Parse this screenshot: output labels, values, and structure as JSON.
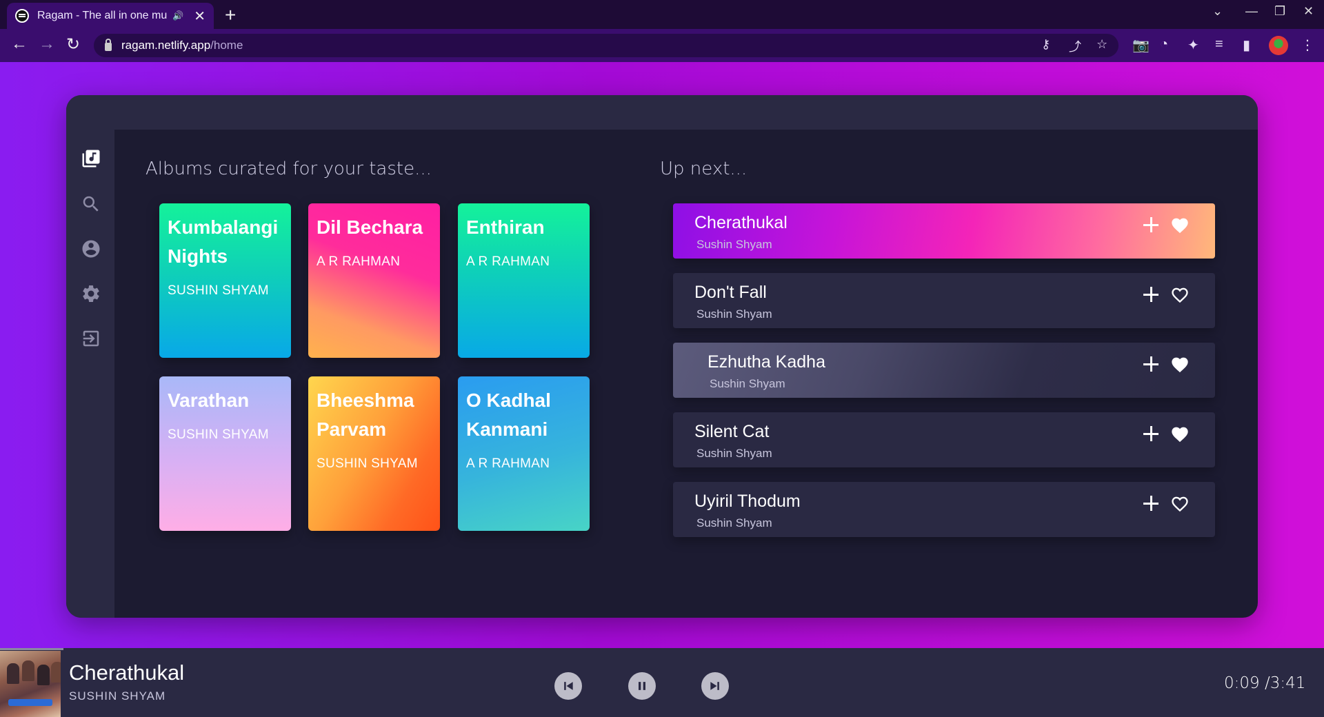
{
  "browser": {
    "tab_title": "Ragam - The all in one mu",
    "url_host": "ragam.netlify.app",
    "url_path": "/home"
  },
  "sidebar": {
    "items": [
      {
        "icon": "library-music-icon",
        "active": true
      },
      {
        "icon": "search-icon",
        "active": false
      },
      {
        "icon": "account-icon",
        "active": false
      },
      {
        "icon": "settings-icon",
        "active": false
      },
      {
        "icon": "logout-icon",
        "active": false
      }
    ]
  },
  "albums_section": {
    "title": "Albums curated for your taste...",
    "albums": [
      {
        "title": "Kumbalangi Nights",
        "artist": "SUSHIN SHYAM"
      },
      {
        "title": "Dil Bechara",
        "artist": "A R RAHMAN"
      },
      {
        "title": "Enthiran",
        "artist": "A R RAHMAN"
      },
      {
        "title": "Varathan",
        "artist": "SUSHIN SHYAM"
      },
      {
        "title": "Bheeshma Parvam",
        "artist": "SUSHIN SHYAM"
      },
      {
        "title": "O Kadhal Kanmani",
        "artist": "A R RAHMAN"
      }
    ]
  },
  "queue_section": {
    "title": "Up next...",
    "songs": [
      {
        "title": "Cherathukal",
        "artist": "Sushin Shyam",
        "liked": true
      },
      {
        "title": "Don't Fall",
        "artist": "Sushin Shyam",
        "liked": false
      },
      {
        "title": "Ezhutha Kadha",
        "artist": "Sushin Shyam",
        "liked": true
      },
      {
        "title": "Silent Cat",
        "artist": "Sushin Shyam",
        "liked": true
      },
      {
        "title": "Uyiril Thodum",
        "artist": "Sushin Shyam",
        "liked": false
      }
    ]
  },
  "player": {
    "title": "Cherathukal",
    "artist": "SUSHIN SHYAM",
    "time": "0:09 /3:41"
  },
  "colors": {
    "page_gradient_start": "#8a1cf0",
    "page_gradient_end": "#d10fd9",
    "panel_bg": "#1c1b31",
    "sidebar_bg": "#2a2943"
  }
}
